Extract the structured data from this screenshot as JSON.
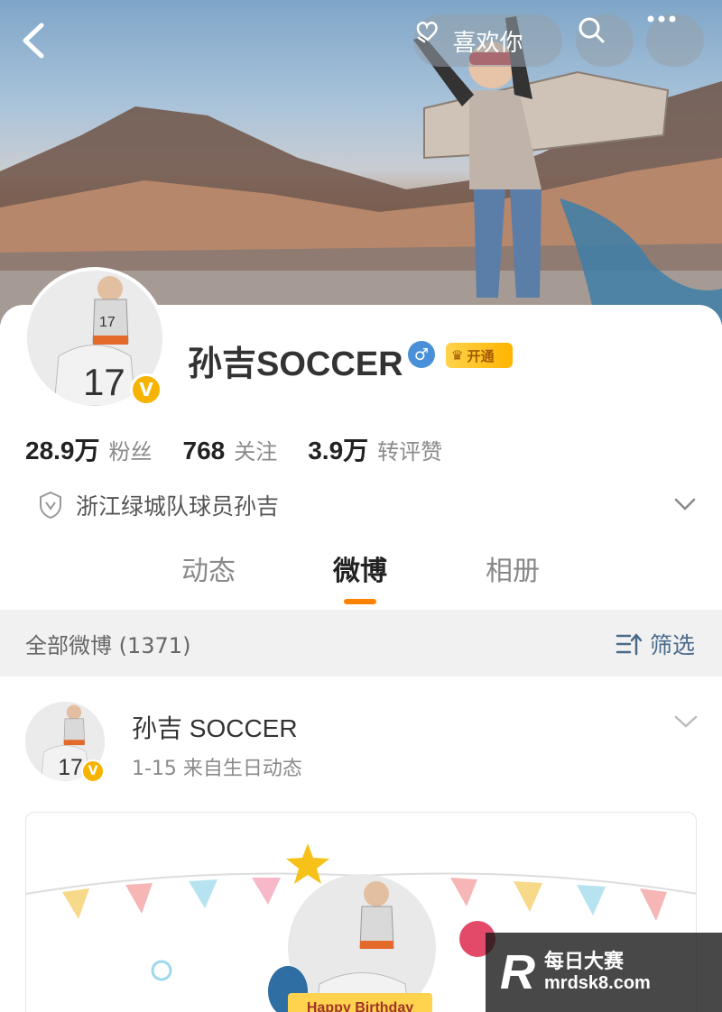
{
  "header": {
    "like_label": "喜欢你",
    "icons": [
      "back-arrow-icon",
      "heart-hand-icon",
      "search-icon",
      "more-dots-icon"
    ]
  },
  "profile": {
    "username": "孙吉SOCCER",
    "vip_label": "开通",
    "stats": [
      {
        "value": "28.9万",
        "label": "粉丝"
      },
      {
        "value": "768",
        "label": "关注"
      },
      {
        "value": "3.9万",
        "label": "转评赞"
      }
    ],
    "bio": "浙江绿城队球员孙吉"
  },
  "tabs": [
    {
      "label": "动态",
      "active": false
    },
    {
      "label": "微博",
      "active": true
    },
    {
      "label": "相册",
      "active": false
    }
  ],
  "feed": {
    "title": "全部微博 (1371)",
    "filter_label": "筛选"
  },
  "post": {
    "author": "孙吉 SOCCER",
    "meta": "1-15  来自生日动态",
    "card_text": "Happy Birthday"
  },
  "watermark": {
    "logo": "R",
    "line1": "每日大赛",
    "line2": "mrdsk8.com"
  },
  "colors": {
    "accent": "#ff8200",
    "link": "#4a6a8c",
    "verified": "#f6b400"
  }
}
